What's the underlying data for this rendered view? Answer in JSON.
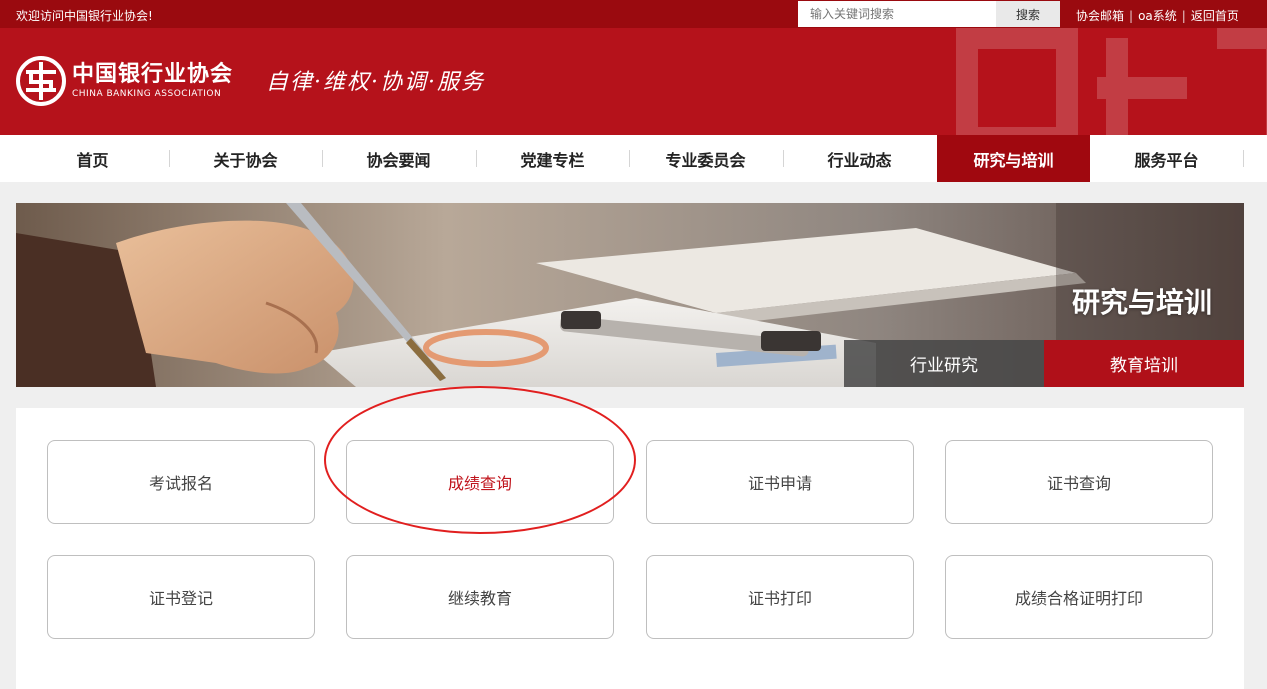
{
  "topbar": {
    "welcome": "欢迎访问中国银行业协会!",
    "search_placeholder": "输入关键词搜索",
    "search_button": "搜索",
    "links": [
      "协会邮箱",
      "oa系统",
      "返回首页"
    ],
    "separator": "|"
  },
  "header": {
    "logo_cn": "中国银行业协会",
    "logo_en": "CHINA BANKING ASSOCIATION",
    "slogan": "自律·维权·协调·服务",
    "brand_color": "#b5121b"
  },
  "nav": {
    "items": [
      "首页",
      "关于协会",
      "协会要闻",
      "党建专栏",
      "专业委员会",
      "行业动态",
      "研究与培训",
      "服务平台"
    ],
    "active_index": 6
  },
  "banner": {
    "title": "研究与培训",
    "tabs": [
      "行业研究",
      "教育培训"
    ],
    "active_tab": 1
  },
  "services": {
    "cards": [
      "考试报名",
      "成绩查询",
      "证书申请",
      "证书查询",
      "证书登记",
      "继续教育",
      "证书打印",
      "成绩合格证明打印"
    ],
    "highlighted_index": 1,
    "highlight_color": "#c0141c",
    "annotation_color": "#e11f1f"
  }
}
